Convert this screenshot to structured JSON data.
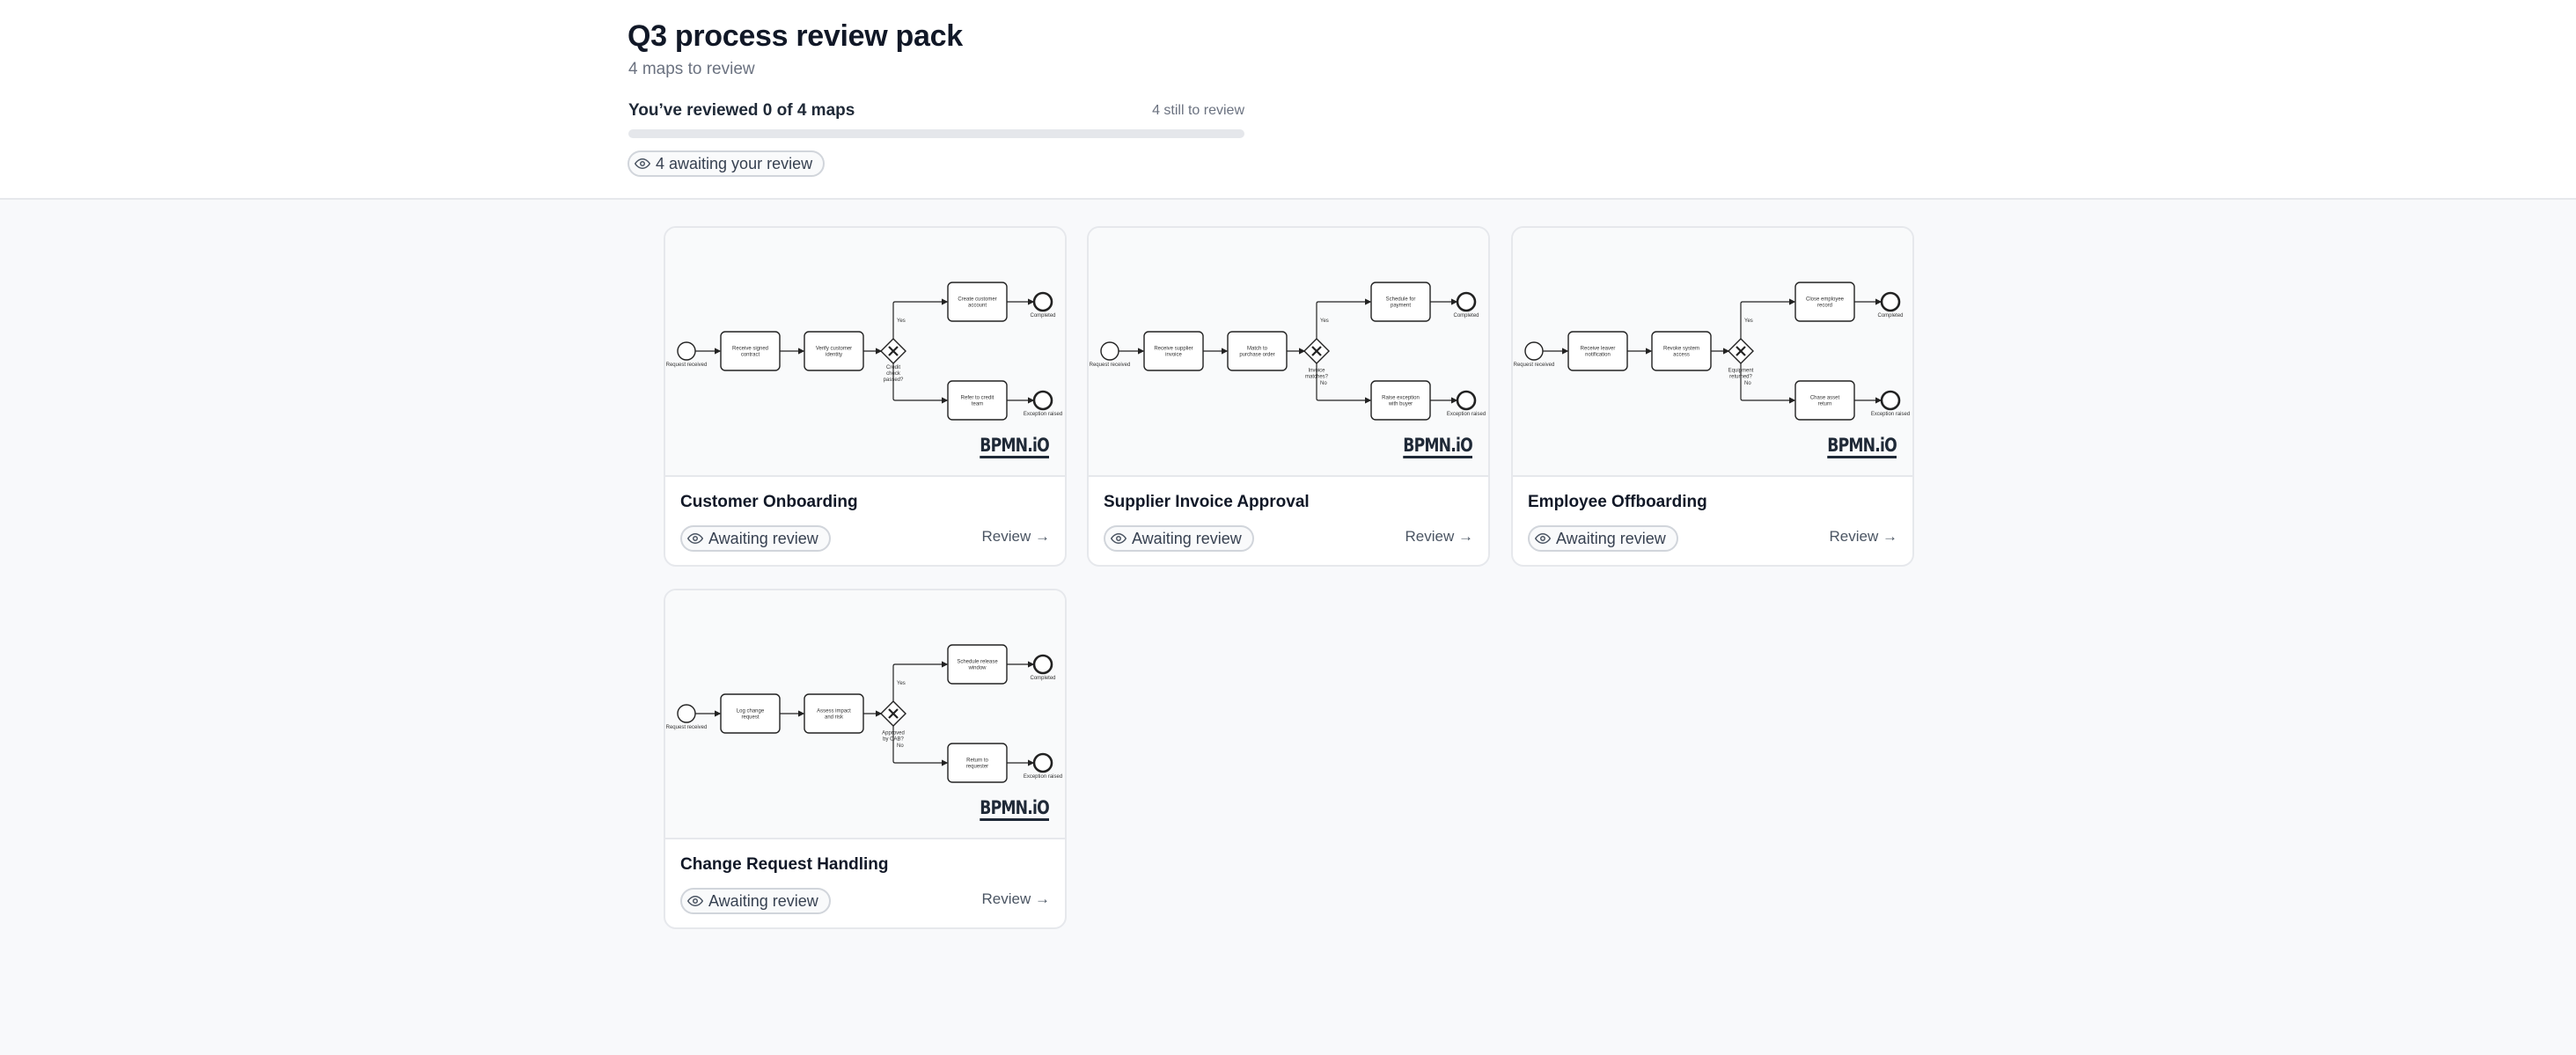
{
  "header": {
    "title": "Q3 process review pack",
    "subtitle": "4 maps to review",
    "progress_label": "You’ve reviewed 0 of 4 maps",
    "progress_remaining": "4 still to review",
    "progress_fraction": 0,
    "awaiting_badge": "4 awaiting your review"
  },
  "logo_text": "BPMN.iO",
  "cards": [
    {
      "title": "Customer Onboarding",
      "status": "Awaiting review",
      "action": "Review →",
      "diagram": {
        "start": "Request received",
        "task1": "Receive signed contract",
        "task2": "Verify customer identity",
        "gateway": "Credit check passed?",
        "yes": "Yes",
        "no": "",
        "task_yes": "Create customer account",
        "task_no": "Refer to credit team",
        "end_yes": "Completed",
        "end_no": "Exception raised"
      }
    },
    {
      "title": "Supplier Invoice Approval",
      "status": "Awaiting review",
      "action": "Review →",
      "diagram": {
        "start": "Request received",
        "task1": "Receive supplier invoice",
        "task2": "Match to purchase order",
        "gateway": "Invoice matches?",
        "yes": "Yes",
        "no": "No",
        "task_yes": "Schedule for payment",
        "task_no": "Raise exception with buyer",
        "end_yes": "Completed",
        "end_no": "Exception raised"
      }
    },
    {
      "title": "Employee Offboarding",
      "status": "Awaiting review",
      "action": "Review →",
      "diagram": {
        "start": "Request received",
        "task1": "Receive leaver notification",
        "task2": "Revoke system access",
        "gateway": "Equipment returned?",
        "yes": "Yes",
        "no": "No",
        "task_yes": "Close employee record",
        "task_no": "Chase asset return",
        "end_yes": "Completed",
        "end_no": "Exception raised"
      }
    },
    {
      "title": "Change Request Handling",
      "status": "Awaiting review",
      "action": "Review →",
      "diagram": {
        "start": "Request received",
        "task1": "Log change request",
        "task2": "Assess impact and risk",
        "gateway": "Approved by CAB?",
        "yes": "Yes",
        "no": "No",
        "task_yes": "Schedule release window",
        "task_no": "Return to requester",
        "end_yes": "Completed",
        "end_no": "Exception raised"
      }
    }
  ]
}
